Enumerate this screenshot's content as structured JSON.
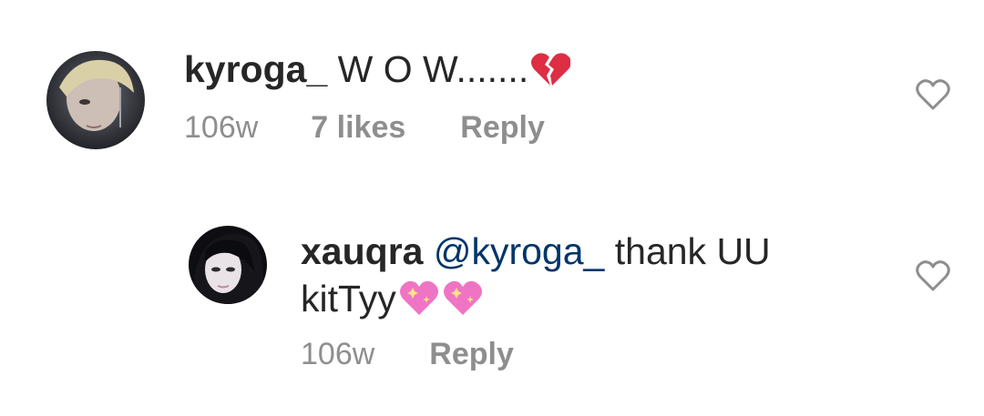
{
  "comments": [
    {
      "username": "kyroga_",
      "text": "W O W.......",
      "emoji": "broken-heart-icon",
      "timestamp": "106w",
      "likes": "7 likes",
      "reply_label": "Reply"
    },
    {
      "username": "xauqra",
      "mention": "@kyroga_",
      "text": "thank UU kitTyy",
      "emoji": "sparkling-heart-icon",
      "emoji_count": 2,
      "timestamp": "106w",
      "reply_label": "Reply"
    }
  ],
  "colors": {
    "text": "#262626",
    "secondary": "#8e8e8e",
    "mention": "#003569",
    "heart_outline": "#8e8e8e"
  }
}
